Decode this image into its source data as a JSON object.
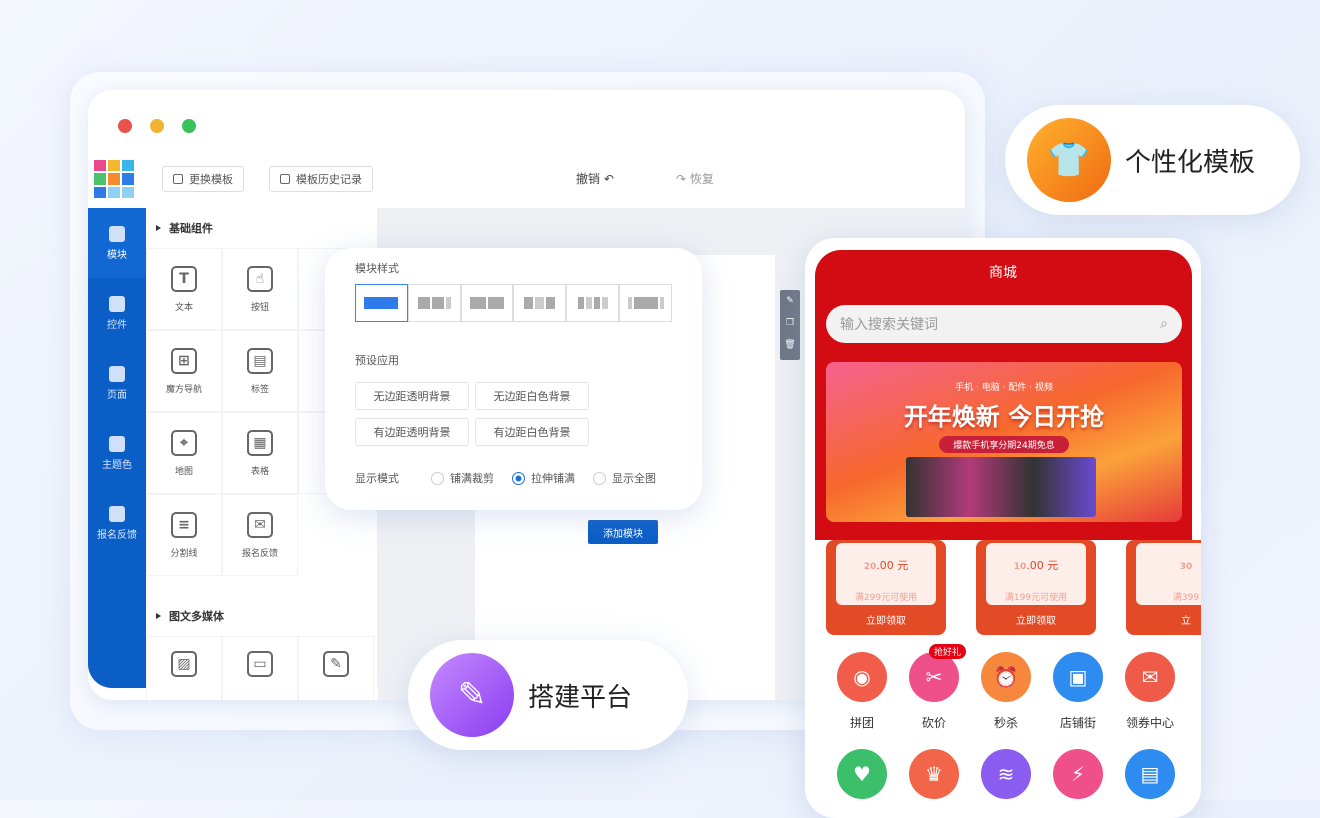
{
  "window": {
    "toolbar": {
      "change_template": "更换模板",
      "template_history": "模板历史记录",
      "undo": "撤销",
      "redo": "恢复"
    },
    "sidebar": [
      {
        "label": "模块",
        "icon": "module-icon"
      },
      {
        "label": "控件",
        "icon": "widget-icon"
      },
      {
        "label": "页面",
        "icon": "page-icon"
      },
      {
        "label": "主题色",
        "icon": "megaphone-icon"
      },
      {
        "label": "报名反馈",
        "icon": "chart-icon"
      }
    ],
    "panel": {
      "basic_title": "基础组件",
      "basic": [
        {
          "label": "文本",
          "glyph": "T"
        },
        {
          "label": "按钮",
          "glyph": "☝"
        },
        {
          "label": "",
          "glyph": ""
        },
        {
          "label": "魔方导航",
          "glyph": "⊞"
        },
        {
          "label": "标签",
          "glyph": "▤"
        },
        {
          "label": "",
          "glyph": ""
        },
        {
          "label": "地图",
          "glyph": "⌖"
        },
        {
          "label": "表格",
          "glyph": "▦"
        },
        {
          "label": "",
          "glyph": ""
        },
        {
          "label": "分割线",
          "glyph": "≡"
        },
        {
          "label": "报名反馈",
          "glyph": "✉"
        }
      ],
      "media_title": "图文多媒体",
      "media": [
        {
          "glyph": "▨"
        },
        {
          "glyph": "▭"
        },
        {
          "glyph": "✎"
        }
      ]
    },
    "add_module": "添加模块"
  },
  "popup": {
    "style_label": "模块样式",
    "preset_label": "预设应用",
    "presets": [
      "无边距透明背景",
      "无边距白色背景",
      "有边距透明背景",
      "有边距白色背景"
    ],
    "display_label": "显示模式",
    "display_options": [
      "铺满裁剪",
      "拉伸铺满",
      "显示全图"
    ],
    "display_selected": "拉伸铺满",
    "accent": "#1c6fd6"
  },
  "badges": {
    "template": "个性化模板",
    "platform": "搭建平台"
  },
  "phone": {
    "title": "商城",
    "search_placeholder": "输入搜索关键词",
    "banner": {
      "tags": "手机 · 电脑 · 配件 · 视频",
      "headline": "开年焕新 今日开抢",
      "sub": "爆款手机享分期24期免息"
    },
    "coupons": [
      {
        "amount": "20",
        "decimal": ".00 元",
        "cond": "满299元可使用",
        "btn": "立即领取"
      },
      {
        "amount": "10",
        "decimal": ".00 元",
        "cond": "满199元可使用",
        "btn": "立即领取"
      },
      {
        "amount": "30",
        "decimal": "",
        "cond": "满399",
        "btn": "立"
      }
    ],
    "nav": [
      {
        "label": "拼团",
        "color": "#f25c4a",
        "glyph": "◉"
      },
      {
        "label": "砍价",
        "color": "#f0508a",
        "glyph": "✂",
        "badge": "抢好礼"
      },
      {
        "label": "秒杀",
        "color": "#f7873c",
        "glyph": "⏰"
      },
      {
        "label": "店铺街",
        "color": "#2e8bf0",
        "glyph": "▣"
      },
      {
        "label": "领券中心",
        "color": "#f05a48",
        "glyph": "✉"
      },
      {
        "label": "",
        "color": "#3cbf6a",
        "glyph": "♥"
      },
      {
        "label": "",
        "color": "#f26548",
        "glyph": "♛"
      },
      {
        "label": "",
        "color": "#8b5cf0",
        "glyph": "≋"
      },
      {
        "label": "",
        "color": "#f0508a",
        "glyph": "⚡"
      },
      {
        "label": "",
        "color": "#2e8bf0",
        "glyph": "▤"
      }
    ],
    "brand_red": "#d30b12"
  }
}
